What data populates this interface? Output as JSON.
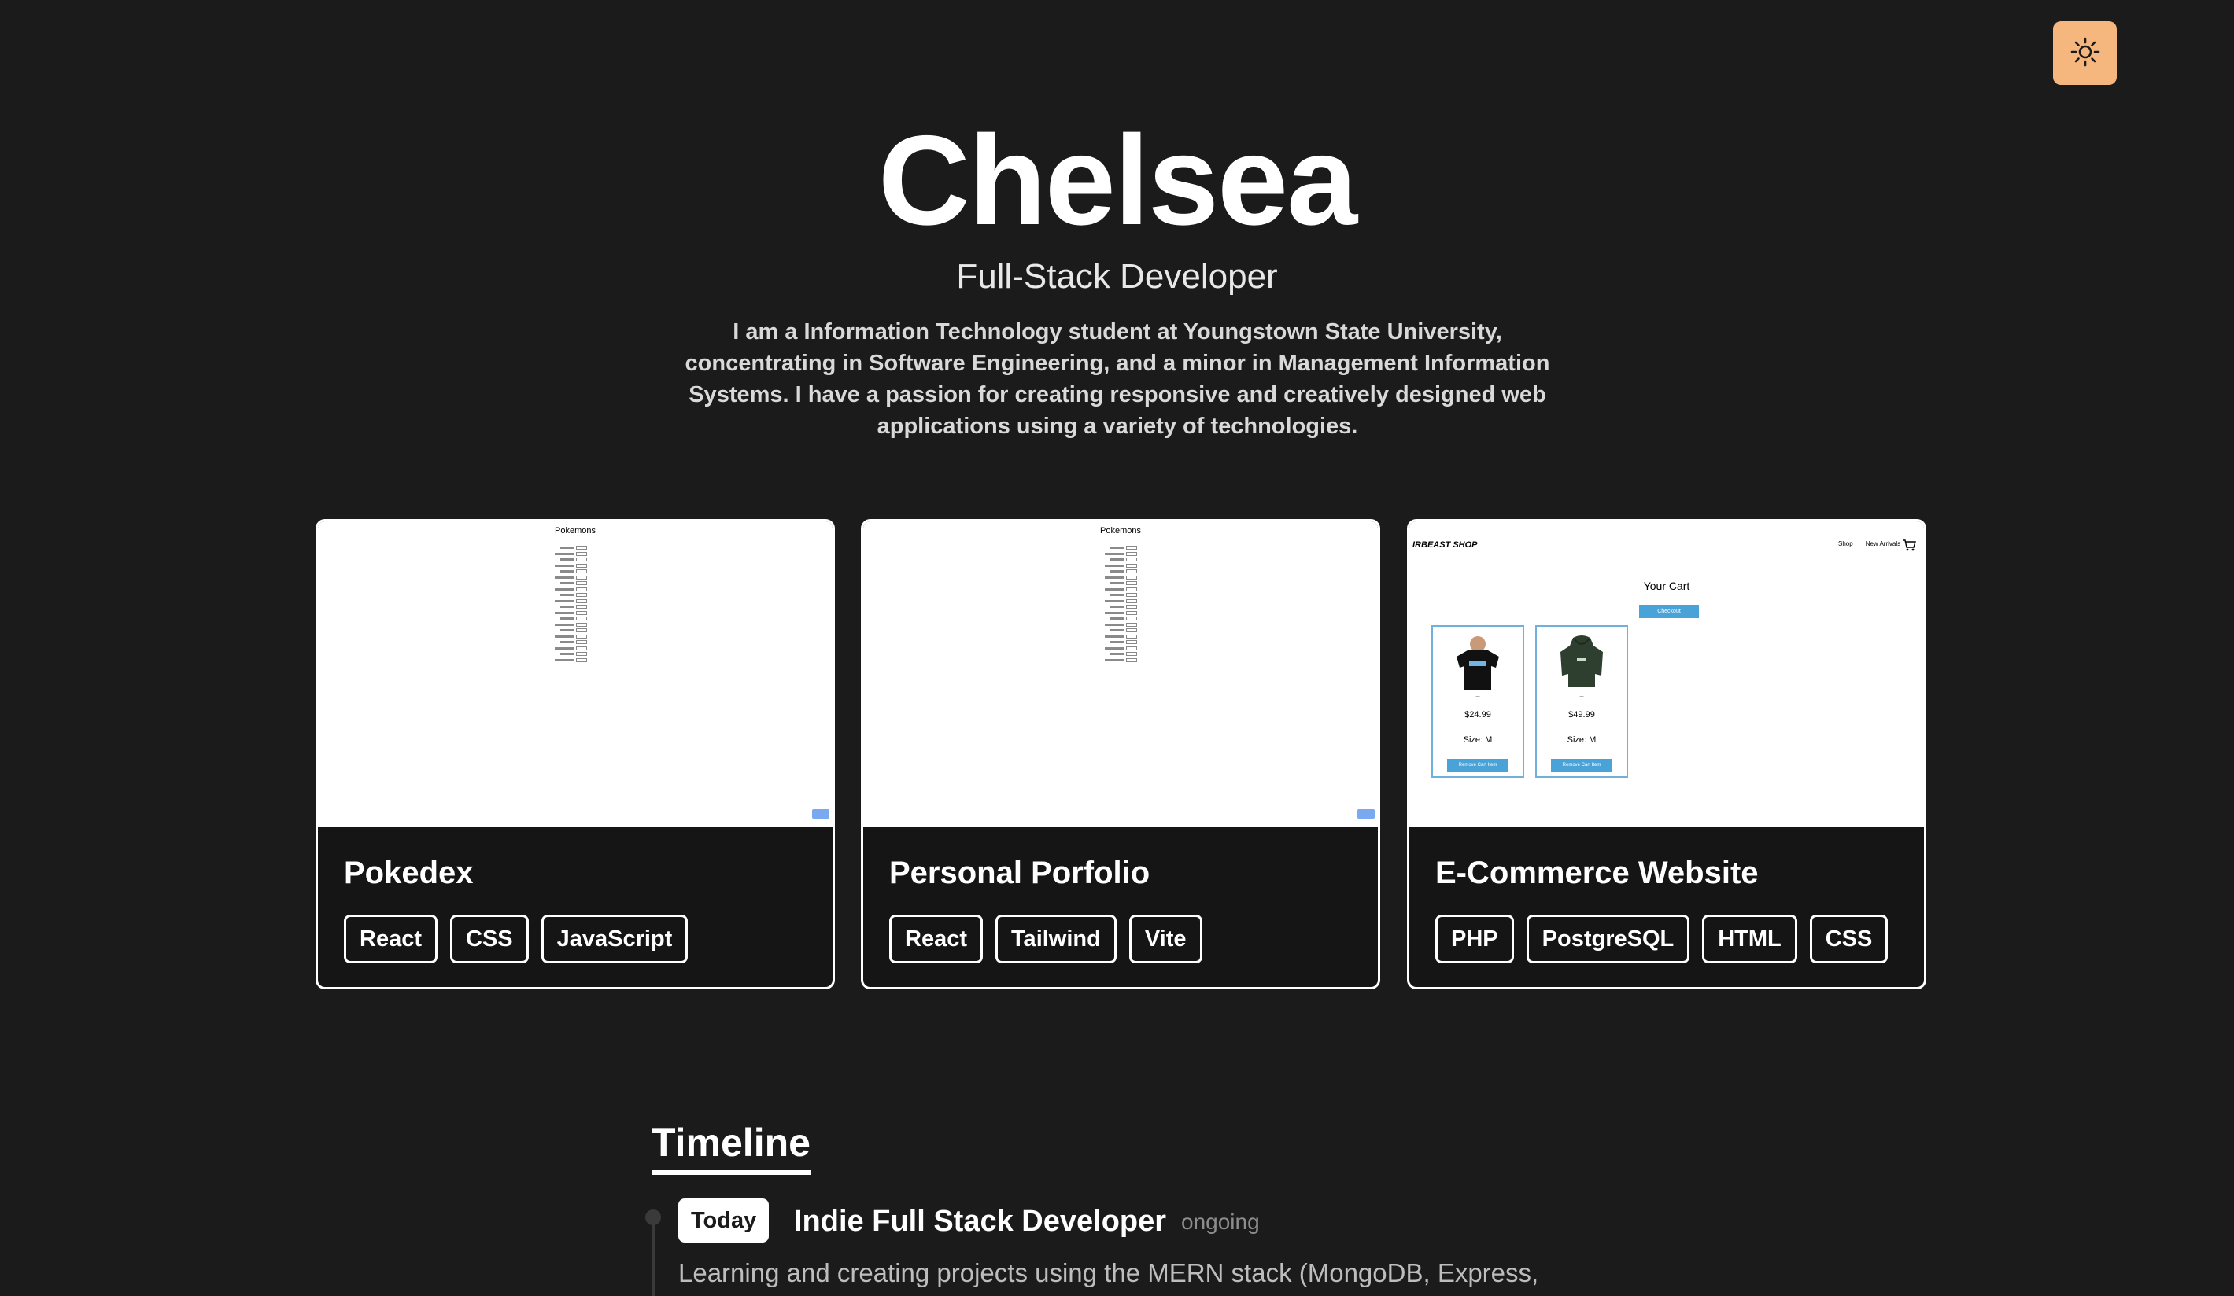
{
  "theme_toggle": {
    "icon": "sun-icon",
    "bg_color": "#f6b77e"
  },
  "hero": {
    "name": "Chelsea",
    "role": "Full-Stack Developer",
    "bio": "I am a Information Technology student at Youngstown State University, concentrating in Software Engineering, and a minor in Management Information Systems. I have a passion for creating responsive and creatively designed web applications using a variety of technologies."
  },
  "projects": [
    {
      "title": "Pokedex",
      "tags": [
        "React",
        "CSS",
        "JavaScript"
      ],
      "preview": {
        "heading": "Pokemons"
      }
    },
    {
      "title": "Personal Porfolio",
      "tags": [
        "React",
        "Tailwind",
        "Vite"
      ],
      "preview": {
        "heading": "Pokemons"
      }
    },
    {
      "title": "E-Commerce Website",
      "tags": [
        "PHP",
        "PostgreSQL",
        "HTML",
        "CSS"
      ],
      "preview": {
        "logo": "IRBEAST SHOP",
        "nav": [
          "Shop",
          "New Arrivals"
        ],
        "heading": "Your Cart",
        "checkout": "Checkout",
        "products": [
          {
            "price": "$24.99",
            "size": "Size: M",
            "button": "Remove Cart Item"
          },
          {
            "price": "$49.99",
            "size": "Size: M",
            "button": "Remove Cart Item"
          }
        ]
      }
    }
  ],
  "timeline": {
    "heading": "Timeline",
    "items": [
      {
        "badge": "Today",
        "title": "Indie Full Stack Developer",
        "status": "ongoing",
        "description": "Learning and creating projects using the MERN stack (MongoDB, Express,"
      }
    ]
  }
}
